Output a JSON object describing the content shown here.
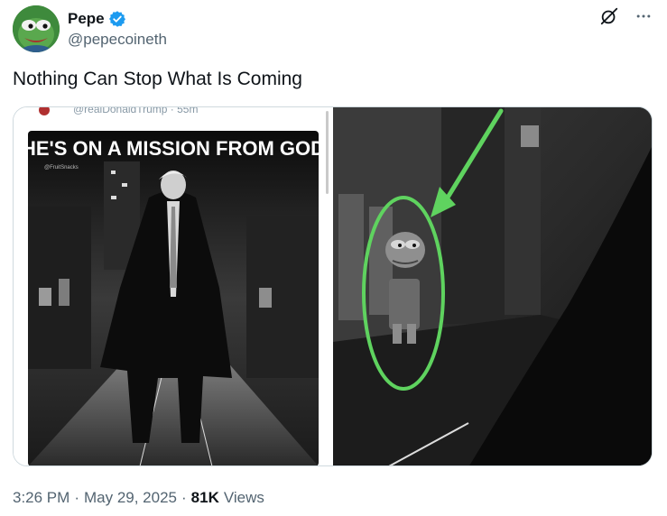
{
  "author": {
    "display_name": "Pepe",
    "handle": "@pepecoineth",
    "verified": true,
    "avatar_icon": "pepe-frog-avatar"
  },
  "actions": {
    "grok_icon": "grok-icon",
    "more_icon": "more-dots-icon"
  },
  "tweet": {
    "text": "Nothing Can Stop What Is Coming"
  },
  "media": {
    "left_image": {
      "header_handle": "@realDonaldTrump · 55m",
      "title": "HE'S ON A MISSION FROM GOD",
      "watermark": "@FruitSnacks"
    },
    "right_image": {
      "annotation": "green-arrow-and-ellipse"
    }
  },
  "footer": {
    "time": "3:26 PM",
    "separator": "·",
    "date": "May 29, 2025",
    "views_count": "81K",
    "views_label": "Views"
  },
  "colors": {
    "verified_blue": "#1d9bf0",
    "annotation_green": "#5fd35f",
    "secondary_text": "#536471"
  }
}
